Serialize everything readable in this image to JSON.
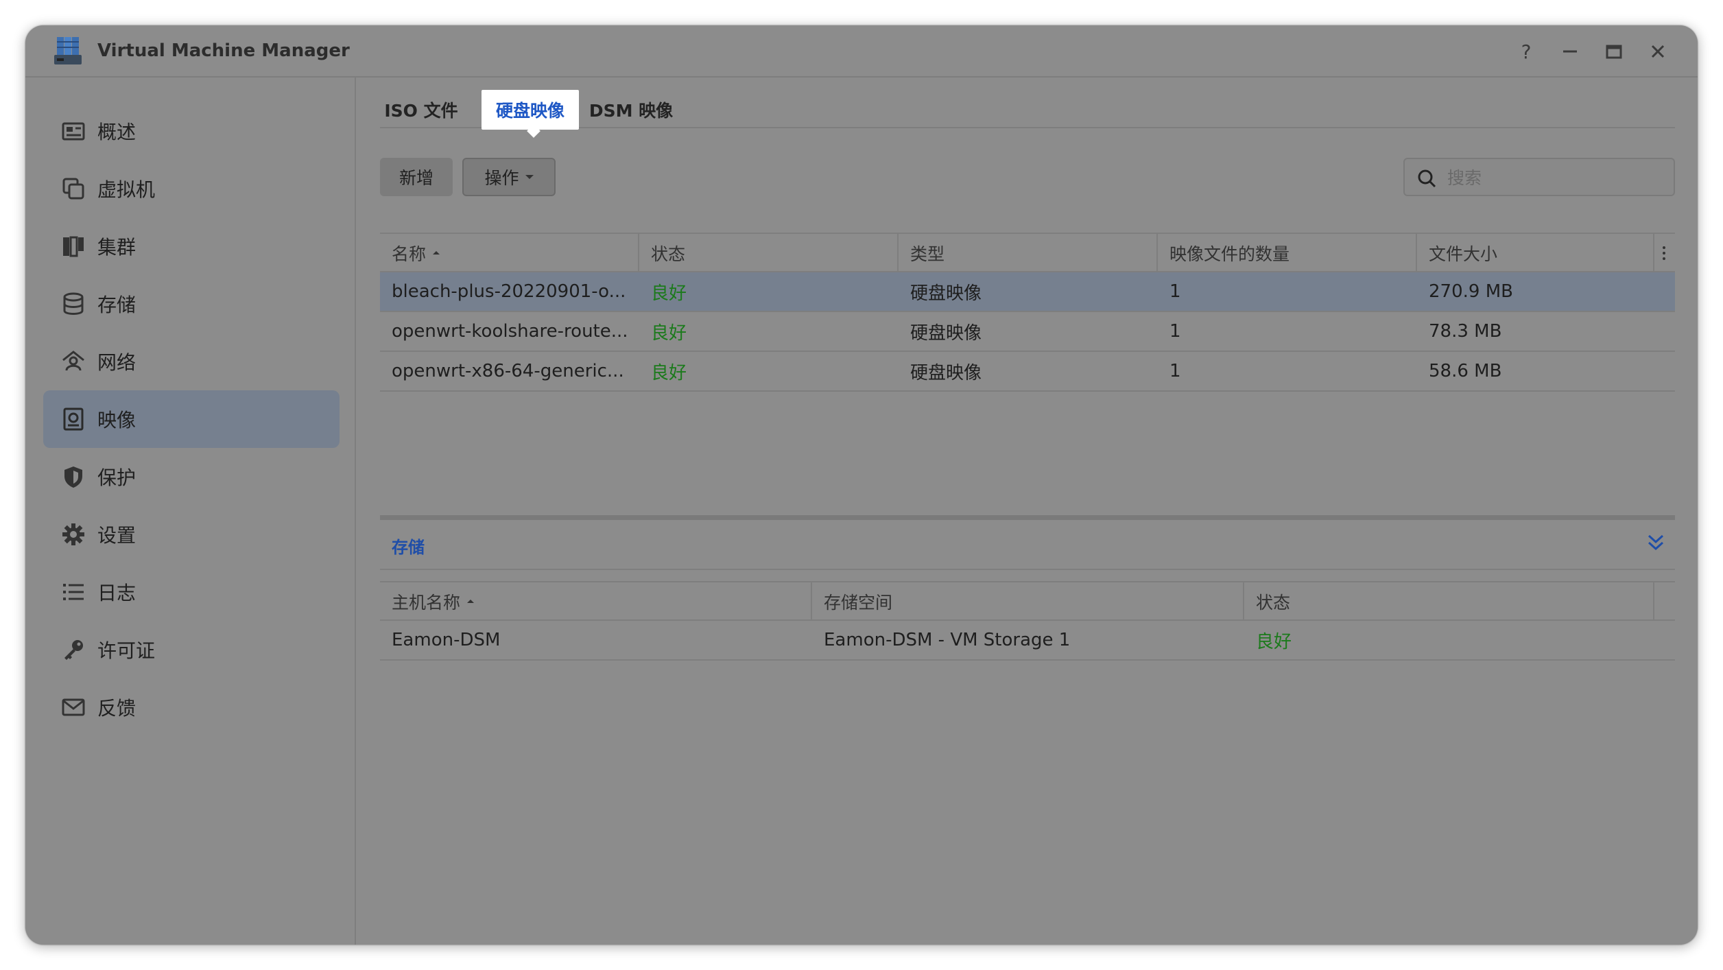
{
  "window": {
    "title": "Virtual Machine Manager"
  },
  "window_controls": {
    "help": "?"
  },
  "sidebar": {
    "items": [
      {
        "label": "概述",
        "icon": "overview-icon",
        "active": false
      },
      {
        "label": "虚拟机",
        "icon": "virtual-machine-icon",
        "active": false
      },
      {
        "label": "集群",
        "icon": "cluster-icon",
        "active": false
      },
      {
        "label": "存储",
        "icon": "storage-icon",
        "active": false
      },
      {
        "label": "网络",
        "icon": "network-icon",
        "active": false
      },
      {
        "label": "映像",
        "icon": "image-icon",
        "active": true
      },
      {
        "label": "保护",
        "icon": "shield-icon",
        "active": false
      },
      {
        "label": "设置",
        "icon": "gear-icon",
        "active": false
      },
      {
        "label": "日志",
        "icon": "list-icon",
        "active": false
      },
      {
        "label": "许可证",
        "icon": "key-icon",
        "active": false
      },
      {
        "label": "反馈",
        "icon": "mail-icon",
        "active": false
      }
    ]
  },
  "tabs": [
    {
      "label": "ISO 文件",
      "active": false
    },
    {
      "label": "硬盘映像",
      "active": true
    },
    {
      "label": "DSM 映像",
      "active": false
    }
  ],
  "toolbar": {
    "add_label": "新增",
    "actions_label": "操作",
    "search_placeholder": "搜索"
  },
  "images_table": {
    "columns": [
      "名称",
      "状态",
      "类型",
      "映像文件的数量",
      "文件大小"
    ],
    "sorted_column": "名称",
    "rows": [
      {
        "name": "bleach-plus-20220901-o...",
        "status": "良好",
        "type": "硬盘映像",
        "count": "1",
        "size": "270.9 MB",
        "selected": true
      },
      {
        "name": "openwrt-koolshare-route...",
        "status": "良好",
        "type": "硬盘映像",
        "count": "1",
        "size": "78.3 MB",
        "selected": false
      },
      {
        "name": "openwrt-x86-64-generic...",
        "status": "良好",
        "type": "硬盘映像",
        "count": "1",
        "size": "58.6 MB",
        "selected": false
      }
    ]
  },
  "storage_panel": {
    "title": "存储",
    "columns": [
      "主机名称",
      "存储空间",
      "状态"
    ],
    "sorted_column": "主机名称",
    "rows": [
      {
        "host": "Eamon-DSM",
        "volume": "Eamon-DSM - VM Storage 1",
        "status": "良好"
      }
    ]
  },
  "colors": {
    "overlay_gray": "#8c8c8c",
    "accent_blue": "#1f58c5",
    "status_green": "#1b7a1b",
    "selected_row": "#76808f"
  }
}
